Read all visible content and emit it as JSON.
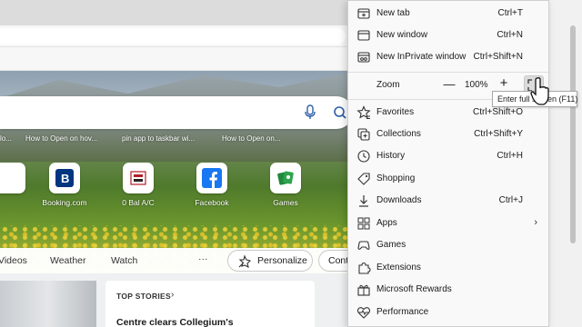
{
  "window": {
    "close_glyph": "✕",
    "more_glyph": "···"
  },
  "ntp": {
    "suggestions": [
      "lo...",
      "How to Open on hov...",
      "pin app to taskbar wi...",
      "How to Open on..."
    ],
    "tiles": [
      {
        "label": "Booking.com",
        "icon": "booking-icon"
      },
      {
        "label": "0 Bal A/C",
        "icon": "bank-icon"
      },
      {
        "label": "Facebook",
        "icon": "facebook-icon"
      },
      {
        "label": "Games",
        "icon": "games-cards-icon"
      }
    ],
    "feed_tabs": [
      "Videos",
      "Weather",
      "Watch"
    ],
    "feed_more": "···",
    "personalize": "Personalize",
    "continue_partial": "Cont",
    "top_stories": "TOP STORIES",
    "top_stories_chevron": "›",
    "headline": "Centre clears Collegium's"
  },
  "menu": {
    "items_top": [
      {
        "label": "New tab",
        "shortcut": "Ctrl+T",
        "icon": "new-tab-icon"
      },
      {
        "label": "New window",
        "shortcut": "Ctrl+N",
        "icon": "new-window-icon"
      },
      {
        "label": "New InPrivate window",
        "shortcut": "Ctrl+Shift+N",
        "icon": "inprivate-icon"
      }
    ],
    "zoom": {
      "label": "Zoom",
      "minus": "—",
      "value": "100%",
      "plus": "+"
    },
    "fullscreen_tooltip": "Enter full screen (F11)",
    "items_bottom": [
      {
        "label": "Favorites",
        "shortcut": "Ctrl+Shift+O",
        "icon": "favorites-icon"
      },
      {
        "label": "Collections",
        "shortcut": "Ctrl+Shift+Y",
        "icon": "collections-icon"
      },
      {
        "label": "History",
        "shortcut": "Ctrl+H",
        "icon": "history-icon"
      },
      {
        "label": "Shopping",
        "shortcut": "",
        "icon": "shopping-tag-icon"
      },
      {
        "label": "Downloads",
        "shortcut": "Ctrl+J",
        "icon": "downloads-icon"
      },
      {
        "label": "Apps",
        "shortcut": "",
        "icon": "apps-icon",
        "submenu": "›"
      },
      {
        "label": "Games",
        "shortcut": "",
        "icon": "games-icon"
      },
      {
        "label": "Extensions",
        "shortcut": "",
        "icon": "extensions-icon"
      },
      {
        "label": "Microsoft Rewards",
        "shortcut": "",
        "icon": "rewards-icon"
      },
      {
        "label": "Performance",
        "shortcut": "",
        "icon": "performance-icon"
      }
    ]
  },
  "colors": {
    "menu_bg": "#f9f9f9",
    "facebook": "#1877f2",
    "booking": "#003580",
    "games": "#1e8a3c"
  }
}
